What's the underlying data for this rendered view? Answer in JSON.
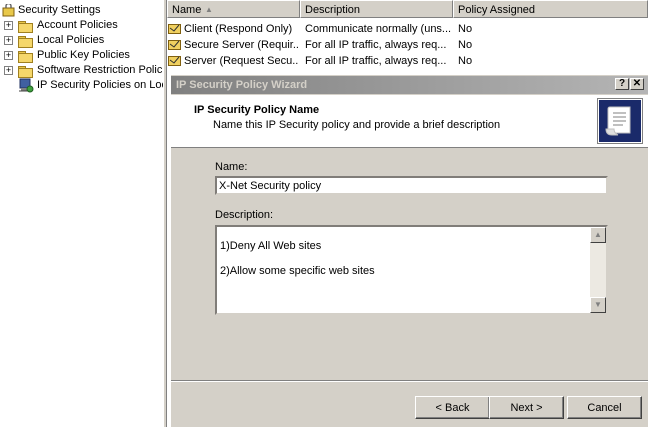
{
  "tree": {
    "items": [
      {
        "label": "Security Settings"
      },
      {
        "label": "Account Policies"
      },
      {
        "label": "Local Policies"
      },
      {
        "label": "Public Key Policies"
      },
      {
        "label": "Software Restriction Policie"
      },
      {
        "label": "IP Security Policies on Loca"
      }
    ]
  },
  "list": {
    "columns": [
      "Name",
      "Description",
      "Policy Assigned"
    ],
    "sort_indicator": "▲",
    "rows": [
      {
        "name": "Client (Respond Only)",
        "description": "Communicate normally (uns...",
        "assigned": "No"
      },
      {
        "name": "Secure Server (Requir...",
        "description": "For all IP traffic, always req...",
        "assigned": "No"
      },
      {
        "name": "Server (Request Secu...",
        "description": "For all IP traffic, always req...",
        "assigned": "No"
      }
    ]
  },
  "wizard": {
    "title": "IP Security Policy Wizard",
    "help_button": "?",
    "close_button": "✕",
    "header_title": "IP Security Policy Name",
    "header_subtitle": "Name this IP Security policy and provide a brief description",
    "name_label": "Name:",
    "name_value": "X-Net Security policy",
    "description_label": "Description:",
    "description_lines": [
      "1)Deny All Web sites",
      "2)Allow some specific web sites"
    ],
    "back_button": "< Back",
    "next_button": "Next >",
    "cancel_button": "Cancel"
  }
}
